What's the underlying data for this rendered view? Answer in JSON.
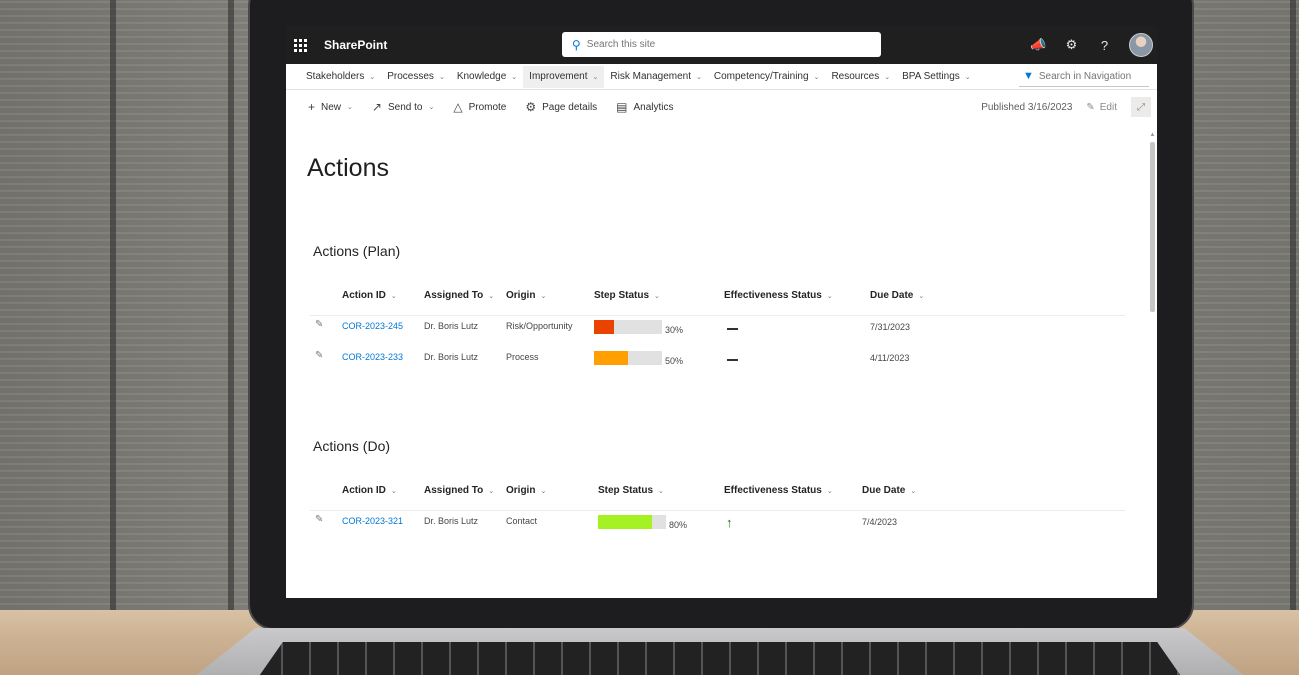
{
  "suitebar": {
    "app_name": "SharePoint",
    "search_placeholder": "Search this site",
    "icons": [
      "waffle-icon",
      "megaphone-icon",
      "gear-icon",
      "help-icon",
      "avatar"
    ]
  },
  "nav": {
    "items": [
      {
        "label": "Stakeholders"
      },
      {
        "label": "Processes"
      },
      {
        "label": "Knowledge"
      },
      {
        "label": "Improvement"
      },
      {
        "label": "Risk Management"
      },
      {
        "label": "Competency/Training"
      },
      {
        "label": "Resources"
      },
      {
        "label": "BPA Settings"
      }
    ],
    "search_placeholder": "Search in Navigation"
  },
  "commandbar": {
    "new": "New",
    "send_to": "Send to",
    "promote": "Promote",
    "page_details": "Page details",
    "analytics": "Analytics",
    "published": "Published 3/16/2023",
    "edit": "Edit"
  },
  "page": {
    "title": "Actions"
  },
  "plan": {
    "title": "Actions (Plan)",
    "columns": [
      "Action ID",
      "Assigned To",
      "Origin",
      "Step Status",
      "Effectiveness Status",
      "Due Date"
    ],
    "rows": [
      {
        "id": "COR-2023-245",
        "assigned": "Dr. Boris Lutz",
        "origin": "Risk/Opportunity",
        "progress": 0.3,
        "progress_label": "30%",
        "color": "#ea4300",
        "due": "7/31/2023"
      },
      {
        "id": "COR-2023-233",
        "assigned": "Dr. Boris Lutz",
        "origin": "Process",
        "progress": 0.5,
        "progress_label": "50%",
        "color": "#ff9f00",
        "due": "4/11/2023"
      }
    ]
  },
  "do": {
    "title": "Actions (Do)",
    "columns": [
      "Action ID",
      "Assigned To",
      "Origin",
      "Step Status",
      "Effectiveness Status",
      "Due Date"
    ],
    "rows": [
      {
        "id": "COR-2023-321",
        "assigned": "Dr. Boris Lutz",
        "origin": "Contact",
        "progress": 0.8,
        "progress_label": "80%",
        "color": "#a5f224",
        "effectiveness": "up-arrow",
        "due": "7/4/2023"
      }
    ]
  }
}
